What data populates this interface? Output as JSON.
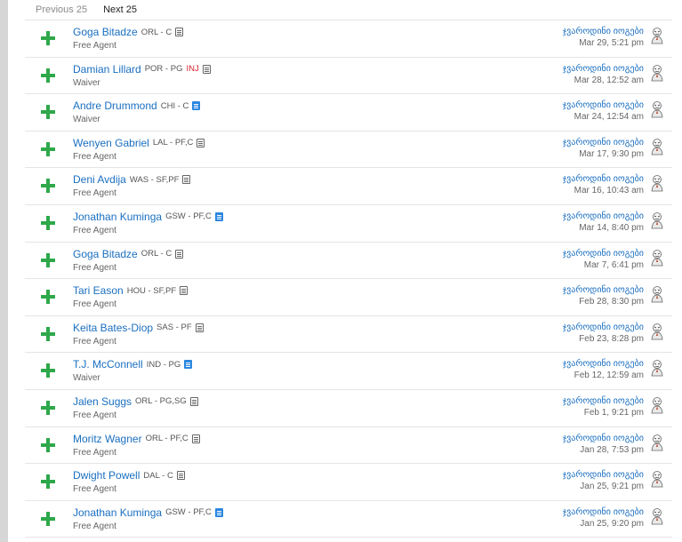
{
  "pager": {
    "previous": "Previous 25",
    "next": "Next 25"
  },
  "transactions": [
    {
      "name": "Goga Bitadze",
      "team": "ORL - C",
      "inj": "",
      "note": "gray",
      "status": "Free Agent",
      "owner": "ჯვაროდინი იოგები",
      "date": "Mar 29, 5:21 pm"
    },
    {
      "name": "Damian Lillard",
      "team": "POR - PG",
      "inj": "INJ",
      "note": "gray",
      "status": "Waiver",
      "owner": "ჯვაროდინი იოგები",
      "date": "Mar 28, 12:52 am"
    },
    {
      "name": "Andre Drummond",
      "team": "CHI - C",
      "inj": "",
      "note": "blue",
      "status": "Waiver",
      "owner": "ჯვაროდინი იოგები",
      "date": "Mar 24, 12:54 am"
    },
    {
      "name": "Wenyen Gabriel",
      "team": "LAL - PF,C",
      "inj": "",
      "note": "gray",
      "status": "Free Agent",
      "owner": "ჯვაროდინი იოგები",
      "date": "Mar 17, 9:30 pm"
    },
    {
      "name": "Deni Avdija",
      "team": "WAS - SF,PF",
      "inj": "",
      "note": "gray",
      "status": "Free Agent",
      "owner": "ჯვაროდინი იოგები",
      "date": "Mar 16, 10:43 am"
    },
    {
      "name": "Jonathan Kuminga",
      "team": "GSW - PF,C",
      "inj": "",
      "note": "blue",
      "status": "Free Agent",
      "owner": "ჯვაროდინი იოგები",
      "date": "Mar 14, 8:40 pm"
    },
    {
      "name": "Goga Bitadze",
      "team": "ORL - C",
      "inj": "",
      "note": "gray",
      "status": "Free Agent",
      "owner": "ჯვაროდინი იოგები",
      "date": "Mar 7, 6:41 pm"
    },
    {
      "name": "Tari Eason",
      "team": "HOU - SF,PF",
      "inj": "",
      "note": "gray",
      "status": "Free Agent",
      "owner": "ჯვაროდინი იოგები",
      "date": "Feb 28, 8:30 pm"
    },
    {
      "name": "Keita Bates-Diop",
      "team": "SAS - PF",
      "inj": "",
      "note": "gray",
      "status": "Free Agent",
      "owner": "ჯვაროდინი იოგები",
      "date": "Feb 23, 8:28 pm"
    },
    {
      "name": "T.J. McConnell",
      "team": "IND - PG",
      "inj": "",
      "note": "blue",
      "status": "Waiver",
      "owner": "ჯვაროდინი იოგები",
      "date": "Feb 12, 12:59 am"
    },
    {
      "name": "Jalen Suggs",
      "team": "ORL - PG,SG",
      "inj": "",
      "note": "gray",
      "status": "Free Agent",
      "owner": "ჯვაროდინი იოგები",
      "date": "Feb 1, 9:21 pm"
    },
    {
      "name": "Moritz Wagner",
      "team": "ORL - PF,C",
      "inj": "",
      "note": "gray",
      "status": "Free Agent",
      "owner": "ჯვაროდინი იოგები",
      "date": "Jan 28, 7:53 pm"
    },
    {
      "name": "Dwight Powell",
      "team": "DAL - C",
      "inj": "",
      "note": "gray",
      "status": "Free Agent",
      "owner": "ჯვაროდინი იოგები",
      "date": "Jan 25, 9:21 pm"
    },
    {
      "name": "Jonathan Kuminga",
      "team": "GSW - PF,C",
      "inj": "",
      "note": "blue",
      "status": "Free Agent",
      "owner": "ჯვაროდინი იოგები",
      "date": "Jan 25, 9:20 pm"
    }
  ]
}
